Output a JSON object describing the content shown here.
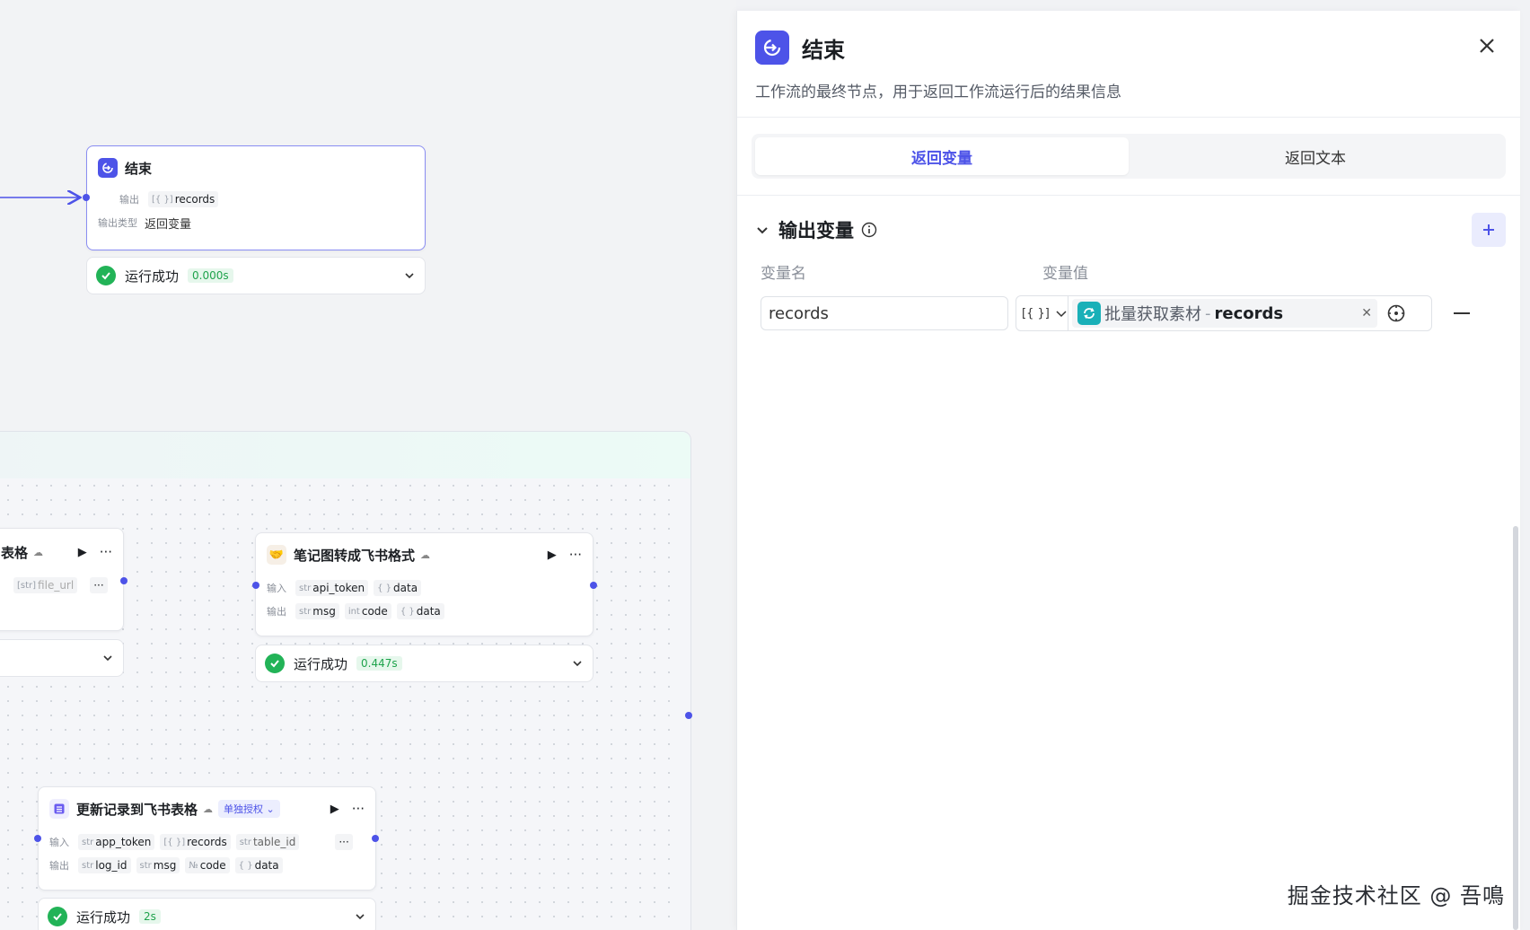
{
  "canvas": {
    "end_node": {
      "title": "结束",
      "output_label": "输出",
      "output_var": "records",
      "output_type_label": "输出类型",
      "output_type_value": "返回变量",
      "status_text": "运行成功",
      "duration": "0.000s"
    },
    "node_table": {
      "title_fragment": "表格",
      "input_tag": "file_url",
      "more": "···"
    },
    "node_convert": {
      "title": "笔记图转成飞书格式",
      "input_label": "输入",
      "output_label": "输出",
      "inputs": [
        {
          "type": "str",
          "name": "api_token"
        },
        {
          "type": "{ }",
          "name": "data"
        }
      ],
      "outputs": [
        {
          "type": "str",
          "name": "msg"
        },
        {
          "type": "int",
          "name": "code"
        },
        {
          "type": "{ }",
          "name": "data"
        }
      ],
      "status_text": "运行成功",
      "duration": "0.447s"
    },
    "node_update": {
      "title": "更新记录到飞书表格",
      "auth_badge": "单独授权",
      "input_label": "输入",
      "output_label": "输出",
      "inputs": [
        {
          "type": "str",
          "name": "app_token"
        },
        {
          "type": "[{ }]",
          "name": "records"
        },
        {
          "type": "str",
          "name": "table_id"
        }
      ],
      "outputs": [
        {
          "type": "str",
          "name": "log_id"
        },
        {
          "type": "str",
          "name": "msg"
        },
        {
          "type": "№",
          "name": "code"
        },
        {
          "type": "{ }",
          "name": "data"
        }
      ],
      "status_text": "运行成功",
      "duration": "2s"
    }
  },
  "panel": {
    "title": "结束",
    "description": "工作流的最终节点，用于返回工作流运行后的结果信息",
    "tabs": [
      {
        "label": "返回变量",
        "active": true
      },
      {
        "label": "返回文本",
        "active": false
      }
    ],
    "section_title": "输出变量",
    "col_name": "变量名",
    "col_value": "变量值",
    "row": {
      "name": "records",
      "type_symbol": "[{ }]",
      "ref_source": "批量获取素材",
      "ref_sep": "-",
      "ref_var": "records"
    }
  },
  "watermark": "掘金技术社区 @ 吾鳴",
  "colors": {
    "accent": "#4d53e8",
    "success": "#22b357",
    "ref_icon": "#1ab0b8"
  }
}
